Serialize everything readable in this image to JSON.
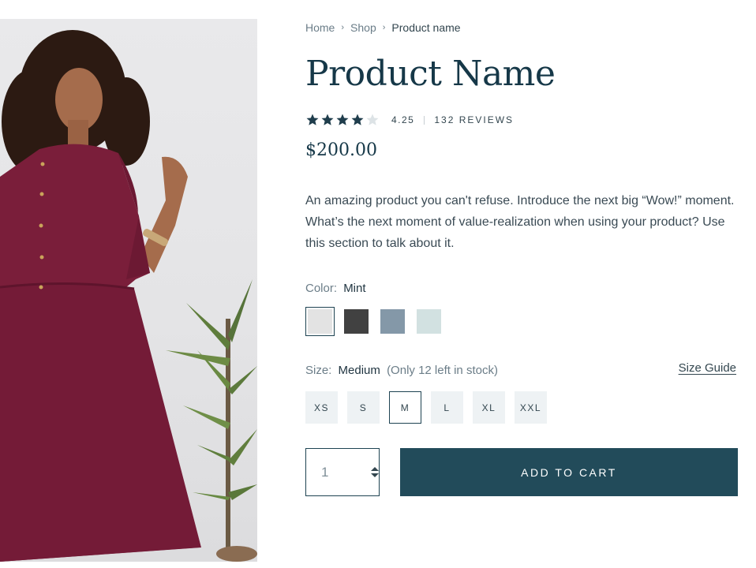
{
  "breadcrumb": {
    "items": [
      "Home",
      "Shop",
      "Product name"
    ],
    "separator": "›"
  },
  "product": {
    "title": "Product Name",
    "rating": {
      "stars_filled": 4,
      "stars_total": 5,
      "value": "4.25",
      "reviews": "132 REVIEWS"
    },
    "price": "$200.00",
    "description": "An amazing product you can't refuse. Introduce the next big “Wow!” moment. What’s the next moment of value-realization when using your product? Use this section to talk about it."
  },
  "color": {
    "label": "Color:",
    "selected": "Mint",
    "swatches": [
      {
        "color": "#e3e3e3",
        "selected": true
      },
      {
        "color": "#414141",
        "selected": false
      },
      {
        "color": "#8498a8",
        "selected": false
      },
      {
        "color": "#d2e1e1",
        "selected": false
      }
    ]
  },
  "size": {
    "label": "Size:",
    "selected": "Medium",
    "stock_note": "(Only 12 left in stock)",
    "guide_link": "Size Guide",
    "options": [
      "XS",
      "S",
      "M",
      "L",
      "XL",
      "XXL"
    ],
    "selected_index": 2
  },
  "quantity": {
    "value": "1"
  },
  "cart": {
    "button_label": "ADD TO CART"
  },
  "colors": {
    "primary": "#224b5a",
    "title": "#163848",
    "star": "#1f3d4c",
    "star_empty": "#dde3e6",
    "dress": "#7a1e3a"
  }
}
